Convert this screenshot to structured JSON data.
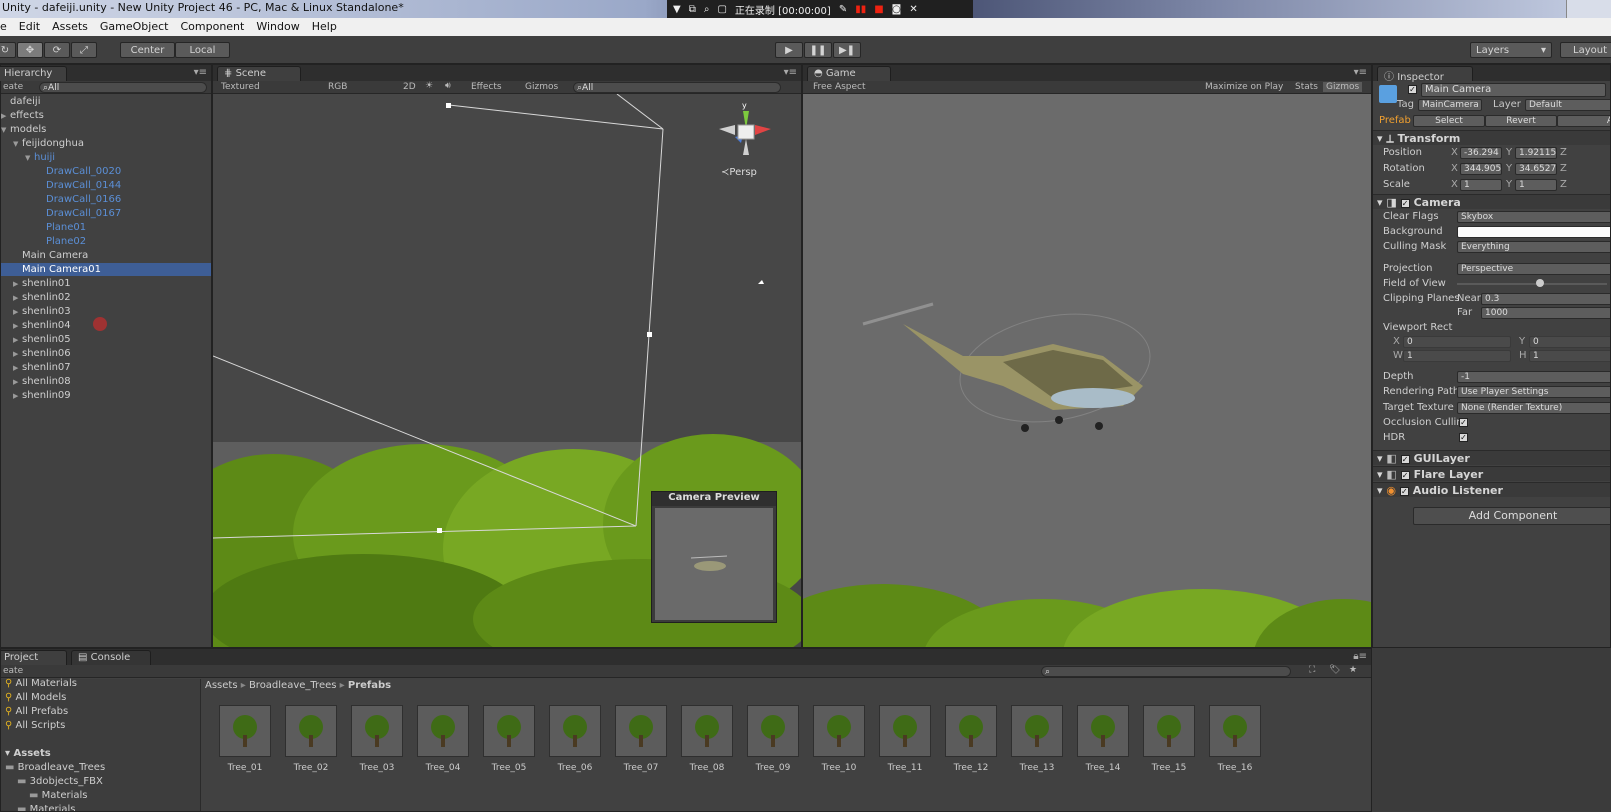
{
  "window": {
    "title": "Unity - dafeiji.unity - New Unity Project 46 - PC, Mac & Linux Standalone*"
  },
  "recorder": {
    "status": "正在录制 [00:00:00]"
  },
  "menu": [
    "e",
    "Edit",
    "Assets",
    "GameObject",
    "Component",
    "Window",
    "Help"
  ],
  "toolbar": {
    "pivot": "Center",
    "space": "Local",
    "layers": "Layers",
    "layout": "Layout"
  },
  "hierarchy": {
    "tab": "Hierarchy",
    "create": "eate",
    "search": "All",
    "items": [
      {
        "label": "dafeiji",
        "indent": 0,
        "arrow": "",
        "color": "normal"
      },
      {
        "label": "effects",
        "indent": 0,
        "arrow": "▶",
        "color": "normal"
      },
      {
        "label": "models",
        "indent": 0,
        "arrow": "▼",
        "color": "normal"
      },
      {
        "label": "feijidonghua",
        "indent": 1,
        "arrow": "▼",
        "color": "normal"
      },
      {
        "label": "huiji",
        "indent": 2,
        "arrow": "▼",
        "color": "blue"
      },
      {
        "label": "DrawCall_0020",
        "indent": 3,
        "arrow": "",
        "color": "blue"
      },
      {
        "label": "DrawCall_0144",
        "indent": 3,
        "arrow": "",
        "color": "blue"
      },
      {
        "label": "DrawCall_0166",
        "indent": 3,
        "arrow": "",
        "color": "blue"
      },
      {
        "label": "DrawCall_0167",
        "indent": 3,
        "arrow": "",
        "color": "blue"
      },
      {
        "label": "Plane01",
        "indent": 3,
        "arrow": "",
        "color": "blue"
      },
      {
        "label": "Plane02",
        "indent": 3,
        "arrow": "",
        "color": "blue"
      },
      {
        "label": "Main Camera",
        "indent": 1,
        "arrow": "",
        "color": "normal"
      },
      {
        "label": "Main Camera01",
        "indent": 1,
        "arrow": "",
        "color": "selected"
      },
      {
        "label": "shenlin01",
        "indent": 1,
        "arrow": "▶",
        "color": "normal"
      },
      {
        "label": "shenlin02",
        "indent": 1,
        "arrow": "▶",
        "color": "normal"
      },
      {
        "label": "shenlin03",
        "indent": 1,
        "arrow": "▶",
        "color": "normal"
      },
      {
        "label": "shenlin04",
        "indent": 1,
        "arrow": "▶",
        "color": "normal"
      },
      {
        "label": "shenlin05",
        "indent": 1,
        "arrow": "▶",
        "color": "normal"
      },
      {
        "label": "shenlin06",
        "indent": 1,
        "arrow": "▶",
        "color": "normal"
      },
      {
        "label": "shenlin07",
        "indent": 1,
        "arrow": "▶",
        "color": "normal"
      },
      {
        "label": "shenlin08",
        "indent": 1,
        "arrow": "▶",
        "color": "normal"
      },
      {
        "label": "shenlin09",
        "indent": 1,
        "arrow": "▶",
        "color": "normal"
      }
    ]
  },
  "scene": {
    "tab": "Scene",
    "shading": "Textured",
    "render": "RGB",
    "mode2d": "2D",
    "effects": "Effects",
    "gizmos": "Gizmos",
    "search": "All",
    "persp": "Persp",
    "gizmo_axis": "y",
    "camera_preview": "Camera Preview"
  },
  "game": {
    "tab": "Game",
    "aspect": "Free Aspect",
    "maximize": "Maximize on Play",
    "stats": "Stats",
    "gizmos": "Gizmos"
  },
  "inspector": {
    "tab": "Inspector",
    "object_name": "Main Camera",
    "tag_label": "Tag",
    "tag": "MainCamera",
    "layer_label": "Layer",
    "layer": "Default",
    "prefab_label": "Prefab",
    "prefab_select": "Select",
    "prefab_revert": "Revert",
    "prefab_apply": "A",
    "transform": {
      "title": "Transform",
      "position": {
        "label": "Position",
        "x": "-36.294",
        "y": "1.92115",
        "z": "Z"
      },
      "rotation": {
        "label": "Rotation",
        "x": "344.905",
        "y": "34.6527",
        "z": "Z"
      },
      "scale": {
        "label": "Scale",
        "x": "1",
        "y": "1",
        "z": "Z"
      }
    },
    "camera": {
      "title": "Camera",
      "rows": [
        {
          "label": "Clear Flags",
          "value": "Skybox"
        },
        {
          "label": "Background",
          "value": ""
        },
        {
          "label": "Culling Mask",
          "value": "Everything"
        },
        {
          "label": "Projection",
          "value": "Perspective"
        },
        {
          "label": "Field of View",
          "value": ""
        },
        {
          "label": "Clipping Planes",
          "value": "0.3"
        },
        {
          "label": "",
          "value": "1000"
        },
        {
          "label": "Viewport Rect",
          "value": ""
        },
        {
          "label": "Depth",
          "value": "-1"
        },
        {
          "label": "Rendering Path",
          "value": "Use Player Settings"
        },
        {
          "label": "Target Texture",
          "value": "None (Render Texture)"
        },
        {
          "label": "Occlusion Culling",
          "value": "✓"
        },
        {
          "label": "HDR",
          "value": "✓"
        }
      ],
      "near": "Near",
      "far": "Far",
      "viewport": {
        "x": "0",
        "y": "0",
        "w": "1",
        "h": "1"
      },
      "fov_fraction": 0.55
    },
    "components": [
      "GUILayer",
      "Flare Layer",
      "Audio Listener"
    ],
    "add_component": "Add Component"
  },
  "project": {
    "tab": "Project",
    "console_tab": "Console",
    "create": "eate",
    "favorites": [
      "All Materials",
      "All Models",
      "All Prefabs",
      "All Scripts"
    ],
    "assets_header": "Assets",
    "folders": [
      {
        "label": "Broadleave_Trees",
        "indent": 0
      },
      {
        "label": "3dobjects_FBX",
        "indent": 1
      },
      {
        "label": "Materials",
        "indent": 2
      },
      {
        "label": "Materials",
        "indent": 1
      }
    ],
    "breadcrumb": [
      "Assets",
      "Broadleave_Trees",
      "Prefabs"
    ],
    "items": [
      "Tree_01",
      "Tree_02",
      "Tree_03",
      "Tree_04",
      "Tree_05",
      "Tree_06",
      "Tree_07",
      "Tree_08",
      "Tree_09",
      "Tree_10",
      "Tree_11",
      "Tree_12",
      "Tree_13",
      "Tree_14",
      "Tree_15",
      "Tree_16"
    ]
  },
  "colors": {
    "selection": "#3e5e96",
    "blue_text": "#5b8fd6",
    "panel": "#414141",
    "foliage": "#6a9a1c"
  }
}
